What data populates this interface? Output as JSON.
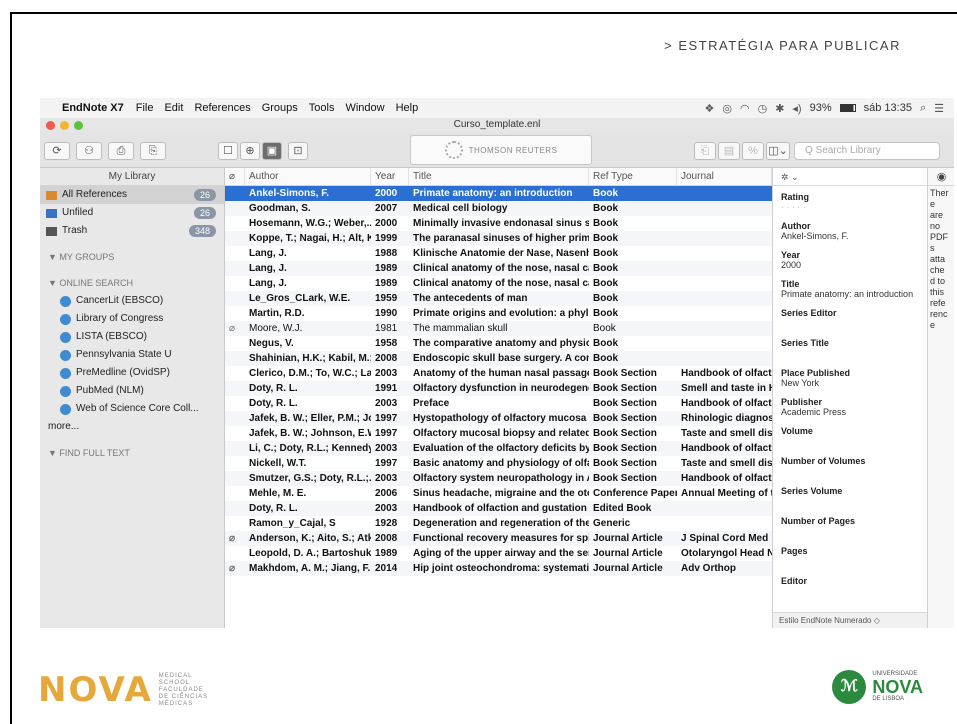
{
  "slide": {
    "header": "> ESTRATÉGIA PARA PUBLICAR"
  },
  "menubar": {
    "app": "EndNote X7",
    "items": [
      "File",
      "Edit",
      "References",
      "Groups",
      "Tools",
      "Window",
      "Help"
    ],
    "battery": "93%",
    "clock": "sáb 13:35"
  },
  "window": {
    "title": "Curso_template.enl"
  },
  "toolbar": {
    "brand": "THOMSON REUTERS",
    "search_placeholder": "Q  Search Library"
  },
  "sidebar": {
    "header": "My Library",
    "library": [
      {
        "label": "All References",
        "count": "26",
        "color": "#d9892e"
      },
      {
        "label": "Unfiled",
        "count": "26",
        "color": "#3a72c4"
      },
      {
        "label": "Trash",
        "count": "348",
        "color": "#555555"
      }
    ],
    "groups": {
      "my_groups": "MY GROUPS",
      "online_search": "ONLINE SEARCH",
      "find_full_text": "FIND FULL TEXT"
    },
    "online": [
      "CancerLit (EBSCO)",
      "Library of Congress",
      "LISTA (EBSCO)",
      "Pennsylvania State U",
      "PreMedline (OvidSP)",
      "PubMed (NLM)",
      "Web of Science Core Coll...",
      "more..."
    ]
  },
  "table": {
    "columns": [
      "Author",
      "Year",
      "Title",
      "Ref Type",
      "Journal"
    ],
    "rows": [
      {
        "author": "Ankel-Simons, F.",
        "year": "2000",
        "title": "Primate anatomy: an introduction",
        "type": "Book",
        "journal": "",
        "clip": false,
        "bold": true
      },
      {
        "author": "Goodman, S.",
        "year": "2007",
        "title": "Medical cell biology",
        "type": "Book",
        "journal": "",
        "clip": false,
        "bold": true
      },
      {
        "author": "Hosemann, W.G.; Weber,...",
        "year": "2000",
        "title": "Minimally invasive endonasal sinus surgery",
        "type": "Book",
        "journal": "",
        "clip": false,
        "bold": true
      },
      {
        "author": "Koppe, T.; Nagai, H.; Alt, K.W.",
        "year": "1999",
        "title": "The paranasal sinuses of higher primate...",
        "type": "Book",
        "journal": "",
        "clip": false,
        "bold": true
      },
      {
        "author": "Lang, J.",
        "year": "1988",
        "title": "Klinische Anatomie der Nase, Nasenhöh...",
        "type": "Book",
        "journal": "",
        "clip": false,
        "bold": true
      },
      {
        "author": "Lang, J.",
        "year": "1989",
        "title": "Clinical anatomy of the nose, nasal cavit...",
        "type": "Book",
        "journal": "",
        "clip": false,
        "bold": true
      },
      {
        "author": "Lang, J.",
        "year": "1989",
        "title": "Clinical anatomy of the nose, nasal cavit...",
        "type": "Book",
        "journal": "",
        "clip": false,
        "bold": true
      },
      {
        "author": "Le_Gros_CLark, W.E.",
        "year": "1959",
        "title": "The antecedents of man",
        "type": "Book",
        "journal": "",
        "clip": false,
        "bold": true
      },
      {
        "author": "Martin, R.D.",
        "year": "1990",
        "title": "Primate origins and evolution: a phyloge...",
        "type": "Book",
        "journal": "",
        "clip": false,
        "bold": true
      },
      {
        "author": "Moore, W.J.",
        "year": "1981",
        "title": "The mammalian skull",
        "type": "Book",
        "journal": "",
        "clip": true,
        "bold": false
      },
      {
        "author": "Negus, V.",
        "year": "1958",
        "title": "The comparative anatomy and physiolog...",
        "type": "Book",
        "journal": "",
        "clip": false,
        "bold": true
      },
      {
        "author": "Shahinian, H.K.; Kabil, M.;...",
        "year": "2008",
        "title": "Endoscopic skull base surgery. A compr...",
        "type": "Book",
        "journal": "",
        "clip": false,
        "bold": true
      },
      {
        "author": "Clerico, D.M.; To, W.C.; La...",
        "year": "2003",
        "title": "Anatomy of the human nasal passages",
        "type": "Book Section",
        "journal": "Handbook of olfaction a",
        "clip": false,
        "bold": true
      },
      {
        "author": "Doty, R. L.",
        "year": "1991",
        "title": "Olfactory dysfunction in neurodegenerat...",
        "type": "Book Section",
        "journal": "Smell and taste in Heal",
        "clip": false,
        "bold": true
      },
      {
        "author": "Doty, R. L.",
        "year": "2003",
        "title": "Preface",
        "type": "Book Section",
        "journal": "Handbook of olfaction a",
        "clip": false,
        "bold": true
      },
      {
        "author": "Jafek, B. W.; Eller, P.M.; Jo...",
        "year": "1997",
        "title": "Hystopathology of olfactory mucosa",
        "type": "Book Section",
        "journal": "Rhinologic diagnosis ar",
        "clip": false,
        "bold": true
      },
      {
        "author": "Jafek, B. W.; Johnson, E.W...",
        "year": "1997",
        "title": "Olfactory mucosal biopsy and related hi...",
        "type": "Book Section",
        "journal": "Taste and smell disord",
        "clip": false,
        "bold": true
      },
      {
        "author": "Li, C.; Doty, R.L.; Kennedy,...",
        "year": "2003",
        "title": "Evaluation of the olfactory deficits by str...",
        "type": "Book Section",
        "journal": "Handbook of olfaction a",
        "clip": false,
        "bold": true
      },
      {
        "author": "Nickell, W.T.",
        "year": "1997",
        "title": "Basic anatomy and physiology of olfaction",
        "type": "Book Section",
        "journal": "Taste and smell disord",
        "clip": false,
        "bold": true
      },
      {
        "author": "Smutzer, G.S.; Doty, R.L.;...",
        "year": "2003",
        "title": "Olfactory system neuropathology in Alz...",
        "type": "Book Section",
        "journal": "Handbook of olfaction a",
        "clip": false,
        "bold": true
      },
      {
        "author": "Mehle, M. E.",
        "year": "2006",
        "title": "Sinus headache, migraine and the otolar...",
        "type": "Conference Paper",
        "journal": "Annual Meeting of the A",
        "clip": false,
        "bold": true
      },
      {
        "author": "Doty, R. L.",
        "year": "2003",
        "title": "Handbook of olfaction and gustation",
        "type": "Edited Book",
        "journal": "",
        "clip": false,
        "bold": true
      },
      {
        "author": "Ramon_y_Cajal, S",
        "year": "1928",
        "title": "Degeneration and regeneration of the ne...",
        "type": "Generic",
        "journal": "",
        "clip": false,
        "bold": true
      },
      {
        "author": "Anderson, K.; Aito, S.; Atki...",
        "year": "2008",
        "title": "Functional recovery measures for spinal...",
        "type": "Journal Article",
        "journal": "J Spinal Cord Med",
        "clip": true,
        "bold": true
      },
      {
        "author": "Leopold, D. A.; Bartoshuk,...",
        "year": "1989",
        "title": "Aging of the upper airway and the sense...",
        "type": "Journal Article",
        "journal": "Otolaryngol Head Neck",
        "clip": false,
        "bold": true
      },
      {
        "author": "Makhdom, A. M.; Jiang, F.;...",
        "year": "2014",
        "title": "Hip joint osteochondroma: systematic r...",
        "type": "Journal Article",
        "journal": "Adv Orthop",
        "clip": true,
        "bold": true
      }
    ]
  },
  "panel": {
    "fields": [
      {
        "label": "Rating",
        "value": "· · · · ·"
      },
      {
        "label": "Author",
        "value": "Ankel-Simons, F."
      },
      {
        "label": "Year",
        "value": "2000"
      },
      {
        "label": "Title",
        "value": "Primate anatomy: an introduction"
      },
      {
        "label": "Series Editor",
        "value": ""
      },
      {
        "label": "Series Title",
        "value": ""
      },
      {
        "label": "Place Published",
        "value": "New York"
      },
      {
        "label": "Publisher",
        "value": "Academic Press"
      },
      {
        "label": "Volume",
        "value": ""
      },
      {
        "label": "Number of Volumes",
        "value": ""
      },
      {
        "label": "Series Volume",
        "value": ""
      },
      {
        "label": "Number of Pages",
        "value": ""
      },
      {
        "label": "Pages",
        "value": ""
      },
      {
        "label": "Editor",
        "value": ""
      }
    ],
    "footer": "Estilo EndNote Numerado ◇"
  },
  "preview": {
    "text": [
      "Ther",
      "e",
      "are",
      "no",
      "PDF",
      "s",
      "atta",
      "che",
      "d to",
      "this",
      "refe",
      "renc",
      "e"
    ]
  },
  "logos": {
    "left": {
      "main": "NOVA",
      "sub": [
        "MEDICAL",
        "SCHOOL",
        "FACULDADE",
        "DE CIÊNCIAS",
        "MÉDICAS"
      ]
    },
    "right": {
      "top": "UNIVERSIDADE",
      "main": "NOVA",
      "bottom": "DE LISBOA"
    }
  }
}
